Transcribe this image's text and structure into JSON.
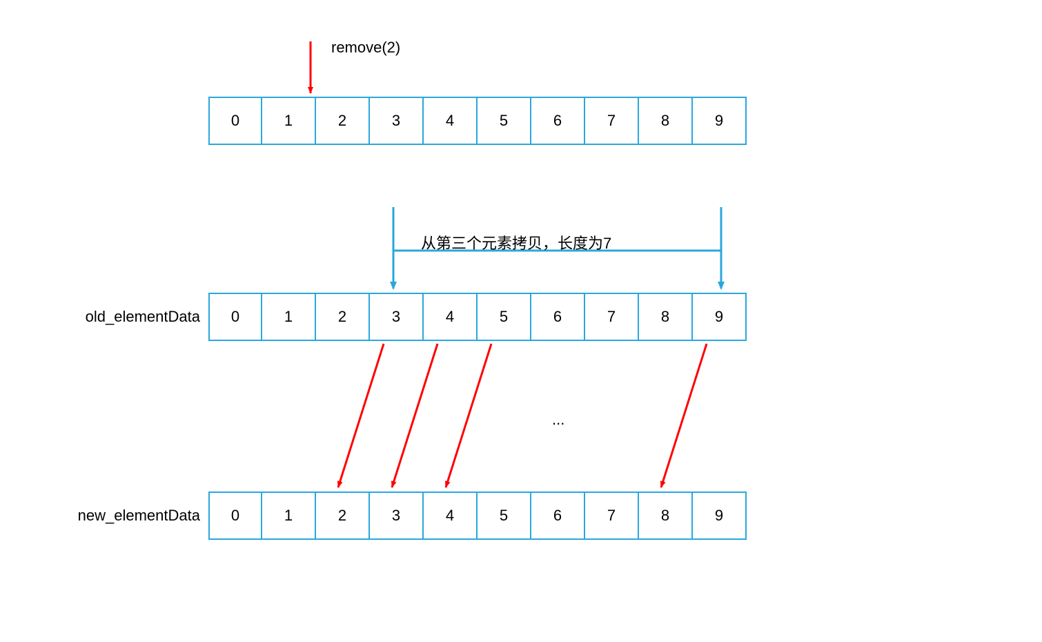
{
  "chart_data": {
    "type": "table",
    "operation": "remove(2)",
    "arrays": [
      {
        "name": null,
        "values": [
          0,
          1,
          2,
          3,
          4,
          5,
          6,
          7,
          8,
          9
        ]
      },
      {
        "name": "old_elementData",
        "values": [
          0,
          1,
          2,
          3,
          4,
          5,
          6,
          7,
          8,
          9
        ]
      },
      {
        "name": "new_elementData",
        "values": [
          0,
          1,
          2,
          3,
          4,
          5,
          6,
          7,
          8,
          9
        ]
      }
    ],
    "copy_note": "从第三个元素拷贝，长度为7",
    "copy_range": {
      "from_index": 3,
      "to_index": 9,
      "length": 7
    },
    "shift_mapping": [
      {
        "from_old_index": 3,
        "to_new_index": 2
      },
      {
        "from_old_index": 4,
        "to_new_index": 3
      },
      {
        "from_old_index": 5,
        "to_new_index": 4
      },
      {
        "from_old_index": 9,
        "to_new_index": 8
      }
    ]
  },
  "labels": {
    "remove_call": "remove(2)",
    "copy_note": "从第三个元素拷贝，长度为7",
    "old_label": "old_elementData",
    "new_label": "new_elementData",
    "ellipsis": "..."
  },
  "cells": {
    "a0": {
      "0": "0",
      "1": "1",
      "2": "2",
      "3": "3",
      "4": "4",
      "5": "5",
      "6": "6",
      "7": "7",
      "8": "8",
      "9": "9"
    },
    "a1": {
      "0": "0",
      "1": "1",
      "2": "2",
      "3": "3",
      "4": "4",
      "5": "5",
      "6": "6",
      "7": "7",
      "8": "8",
      "9": "9"
    },
    "a2": {
      "0": "0",
      "1": "1",
      "2": "2",
      "3": "3",
      "4": "4",
      "5": "5",
      "6": "6",
      "7": "7",
      "8": "8",
      "9": "9"
    }
  }
}
